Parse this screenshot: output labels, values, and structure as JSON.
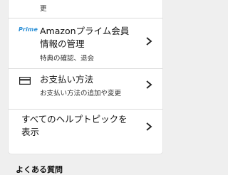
{
  "previous_item": {
    "subtitle_tail": "更"
  },
  "items": [
    {
      "logo_text": "Prime",
      "title_line1": "Amazonプライム会員",
      "title_line2": "情報の管理",
      "subtitle": "特典の確認、退会"
    },
    {
      "title": "お支払い方法",
      "subtitle": "お支払い方法の追加や変更"
    },
    {
      "title_line1": "すべてのヘルプトピックを",
      "title_line2": "表示"
    }
  ],
  "next_section": {
    "heading": "よくある質問"
  },
  "colors": {
    "prime_blue": "#2a8fd6",
    "background": "#efefef",
    "card": "#ffffff"
  }
}
